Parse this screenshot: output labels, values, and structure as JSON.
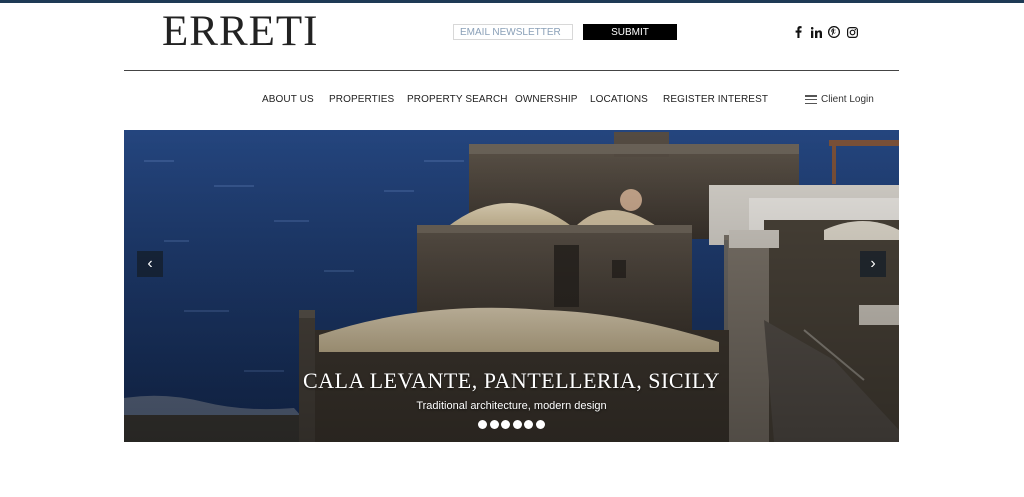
{
  "brand": {
    "logo": "ERRETI"
  },
  "newsletter": {
    "placeholder": "EMAIL NEWSLETTER",
    "submit_label": "SUBMIT"
  },
  "social": [
    {
      "icon": "facebook-icon",
      "glyph": "f"
    },
    {
      "icon": "linkedin-icon",
      "glyph": "in"
    },
    {
      "icon": "pinterest-icon",
      "glyph": "P"
    },
    {
      "icon": "instagram-icon",
      "glyph": "ig"
    }
  ],
  "nav": {
    "items": [
      {
        "label": "ABOUT US"
      },
      {
        "label": "PROPERTIES"
      },
      {
        "label": "PROPERTY SEARCH"
      },
      {
        "label": "OWNERSHIP"
      },
      {
        "label": "LOCATIONS"
      },
      {
        "label": "REGISTER INTEREST"
      }
    ],
    "client_login": "Client Login"
  },
  "slider": {
    "title": "CALA LEVANTE, PANTELLERIA, SICILY",
    "subtitle": "Traditional architecture, modern design",
    "prev_glyph": "‹",
    "next_glyph": "›",
    "slide_count": 6,
    "active_index": 0
  },
  "colors": {
    "topbar": "#1e3a55",
    "button_bg": "#000000",
    "sea": "#1f3d73"
  }
}
